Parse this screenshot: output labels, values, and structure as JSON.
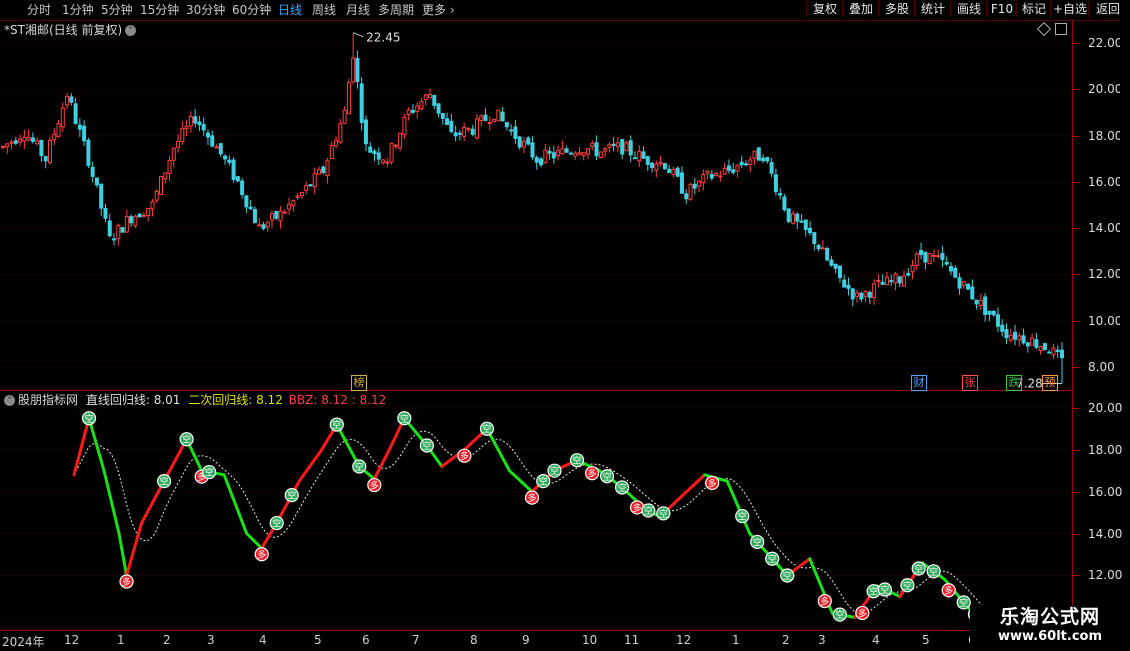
{
  "toolbar": {
    "timeframes": [
      {
        "label": "分时",
        "active": false
      },
      {
        "label": "1分钟",
        "active": false
      },
      {
        "label": "5分钟",
        "active": false
      },
      {
        "label": "15分钟",
        "active": false
      },
      {
        "label": "30分钟",
        "active": false
      },
      {
        "label": "60分钟",
        "active": false
      },
      {
        "label": "日线",
        "active": true
      },
      {
        "label": "周线",
        "active": false
      },
      {
        "label": "月线",
        "active": false
      },
      {
        "label": "多周期",
        "active": false
      },
      {
        "label": "更多",
        "active": false
      }
    ],
    "more_arrow": "›",
    "right_buttons": [
      "复权",
      "叠加",
      "多股",
      "统计",
      "画线",
      "F10",
      "标记",
      "+自选",
      "返回"
    ]
  },
  "main_chart": {
    "title": "*ST湘邮(日线 前复权)",
    "y_ticks": [
      "22.00",
      "20.00",
      "18.00",
      "16.00",
      "14.00",
      "12.00",
      "10.00",
      "8.00"
    ],
    "high_label": "22.45",
    "low_label": "7.28",
    "event_tags": [
      {
        "label": "榜",
        "color": "#d6b03a"
      },
      {
        "label": "财",
        "color": "#4aa3ff"
      },
      {
        "label": "张",
        "color": "#ff4d4d"
      },
      {
        "label": "跌",
        "color": "#39c839"
      },
      {
        "label": "预",
        "color": "#ff9a3a"
      }
    ]
  },
  "sub_chart": {
    "indicator_name": "股朋指标网",
    "line1_label": "直线回归线: 8.01",
    "line2_label": "二次回归线: 8.12",
    "bbz_label": "BBZ: 8.12 : 8.12",
    "y_ticks": [
      "20.00",
      "18.00",
      "16.00",
      "14.00",
      "12.00",
      "10.00"
    ],
    "badge_buy_text": "多",
    "badge_sell_text": "空"
  },
  "x_axis": {
    "labels": [
      "2024年",
      "12",
      "1",
      "2",
      "3",
      "4",
      "5",
      "6",
      "7",
      "8",
      "9",
      "10",
      "11",
      "12",
      "1",
      "2",
      "3",
      "4",
      "5",
      "6"
    ]
  },
  "watermark": {
    "title": "乐淘公式网",
    "url": "www.60lt.com"
  },
  "colors": {
    "up": "#ff4040",
    "down": "#3fd0e0",
    "ma_up": "#ff1a1a",
    "ma_down": "#19e019",
    "grid_axis": "#a00000",
    "active_tab": "#2fa8ff"
  },
  "chart_data": [
    {
      "type": "candlestick",
      "title": "*ST湘邮(日线 前复权)",
      "ylim": [
        7.0,
        23.0
      ],
      "y_ticks": [
        8,
        10,
        12,
        14,
        16,
        18,
        20,
        22
      ],
      "approx_close_path": [
        [
          0,
          17.5
        ],
        [
          5,
          18.2
        ],
        [
          10,
          17.0
        ],
        [
          15,
          19.8
        ],
        [
          20,
          17.0
        ],
        [
          25,
          13.5
        ],
        [
          30,
          14.5
        ],
        [
          35,
          15.0
        ],
        [
          40,
          17.5
        ],
        [
          45,
          18.8
        ],
        [
          50,
          17.5
        ],
        [
          55,
          16.0
        ],
        [
          60,
          14.0
        ],
        [
          65,
          14.6
        ],
        [
          70,
          15.5
        ],
        [
          75,
          16.5
        ],
        [
          80,
          19.0
        ],
        [
          82,
          21.6
        ],
        [
          85,
          17.5
        ],
        [
          90,
          17.0
        ],
        [
          95,
          19.0
        ],
        [
          100,
          19.8
        ],
        [
          105,
          18.0
        ],
        [
          110,
          18.3
        ],
        [
          115,
          19.0
        ],
        [
          120,
          18.0
        ],
        [
          125,
          17.0
        ],
        [
          130,
          17.2
        ],
        [
          135,
          17.5
        ],
        [
          140,
          17.3
        ],
        [
          145,
          17.5
        ],
        [
          150,
          17.0
        ],
        [
          155,
          16.8
        ],
        [
          160,
          15.5
        ],
        [
          165,
          16.2
        ],
        [
          170,
          16.5
        ],
        [
          175,
          17.0
        ],
        [
          178,
          17.2
        ],
        [
          184,
          14.5
        ],
        [
          190,
          13.5
        ],
        [
          195,
          12.0
        ],
        [
          200,
          11.0
        ],
        [
          205,
          11.5
        ],
        [
          210,
          11.8
        ],
        [
          215,
          12.9
        ],
        [
          220,
          12.5
        ],
        [
          225,
          11.5
        ],
        [
          230,
          10.5
        ],
        [
          235,
          9.5
        ],
        [
          240,
          9.2
        ],
        [
          245,
          8.8
        ],
        [
          248,
          8.2
        ]
      ],
      "high": 22.45,
      "low": 7.28
    },
    {
      "type": "line",
      "title": "股朋指标网",
      "ylim": [
        9.5,
        20.5
      ],
      "y_ticks": [
        10,
        12,
        14,
        16,
        18,
        20
      ],
      "series": [
        {
          "name": "直线回归线",
          "last": 8.01
        },
        {
          "name": "二次回归线",
          "last": 8.12
        },
        {
          "name": "BBZ",
          "last": 8.12
        }
      ],
      "regression_path": [
        [
          0,
          16.8
        ],
        [
          4,
          19.5
        ],
        [
          8,
          17.0
        ],
        [
          12,
          14.0
        ],
        [
          14,
          12.0
        ],
        [
          18,
          14.5
        ],
        [
          24,
          16.5
        ],
        [
          30,
          18.5
        ],
        [
          34,
          17.0
        ],
        [
          40,
          16.8
        ],
        [
          46,
          14.0
        ],
        [
          50,
          13.3
        ],
        [
          54,
          14.5
        ],
        [
          60,
          16.5
        ],
        [
          66,
          18.0
        ],
        [
          70,
          19.2
        ],
        [
          76,
          17.2
        ],
        [
          80,
          16.6
        ],
        [
          84,
          18.0
        ],
        [
          88,
          19.5
        ],
        [
          94,
          18.2
        ],
        [
          98,
          17.2
        ],
        [
          104,
          18.0
        ],
        [
          110,
          19.0
        ],
        [
          116,
          17.0
        ],
        [
          122,
          16.0
        ],
        [
          128,
          17.0
        ],
        [
          134,
          17.5
        ],
        [
          140,
          17.0
        ],
        [
          146,
          16.2
        ],
        [
          152,
          15.2
        ],
        [
          156,
          14.8
        ],
        [
          162,
          15.8
        ],
        [
          168,
          16.8
        ],
        [
          174,
          16.5
        ],
        [
          180,
          14.0
        ],
        [
          186,
          12.8
        ],
        [
          190,
          12.0
        ],
        [
          196,
          12.8
        ],
        [
          202,
          10.2
        ],
        [
          208,
          10.0
        ],
        [
          214,
          11.5
        ],
        [
          220,
          11.0
        ],
        [
          226,
          12.6
        ],
        [
          232,
          11.8
        ],
        [
          238,
          10.5
        ],
        [
          242,
          9.8
        ]
      ],
      "signals": [
        {
          "i": 4,
          "type": "空"
        },
        {
          "i": 14,
          "type": "多"
        },
        {
          "i": 24,
          "type": "空"
        },
        {
          "i": 30,
          "type": "空"
        },
        {
          "i": 34,
          "type": "多"
        },
        {
          "i": 36,
          "type": "空"
        },
        {
          "i": 50,
          "type": "多"
        },
        {
          "i": 54,
          "type": "空"
        },
        {
          "i": 58,
          "type": "空"
        },
        {
          "i": 70,
          "type": "空"
        },
        {
          "i": 76,
          "type": "空"
        },
        {
          "i": 80,
          "type": "多"
        },
        {
          "i": 88,
          "type": "空"
        },
        {
          "i": 94,
          "type": "空"
        },
        {
          "i": 104,
          "type": "多"
        },
        {
          "i": 110,
          "type": "空"
        },
        {
          "i": 122,
          "type": "多"
        },
        {
          "i": 125,
          "type": "空"
        },
        {
          "i": 128,
          "type": "空"
        },
        {
          "i": 134,
          "type": "空"
        },
        {
          "i": 138,
          "type": "多"
        },
        {
          "i": 142,
          "type": "空"
        },
        {
          "i": 146,
          "type": "空"
        },
        {
          "i": 150,
          "type": "多"
        },
        {
          "i": 153,
          "type": "空"
        },
        {
          "i": 157,
          "type": "空"
        },
        {
          "i": 170,
          "type": "多"
        },
        {
          "i": 178,
          "type": "空"
        },
        {
          "i": 182,
          "type": "空"
        },
        {
          "i": 186,
          "type": "空"
        },
        {
          "i": 190,
          "type": "空"
        },
        {
          "i": 200,
          "type": "多"
        },
        {
          "i": 204,
          "type": "空"
        },
        {
          "i": 210,
          "type": "多"
        },
        {
          "i": 213,
          "type": "空"
        },
        {
          "i": 216,
          "type": "空"
        },
        {
          "i": 222,
          "type": "空"
        },
        {
          "i": 225,
          "type": "空"
        },
        {
          "i": 229,
          "type": "空"
        },
        {
          "i": 233,
          "type": "多"
        },
        {
          "i": 237,
          "type": "空"
        },
        {
          "i": 240,
          "type": "空"
        },
        {
          "i": 248,
          "type": "空"
        }
      ]
    }
  ]
}
